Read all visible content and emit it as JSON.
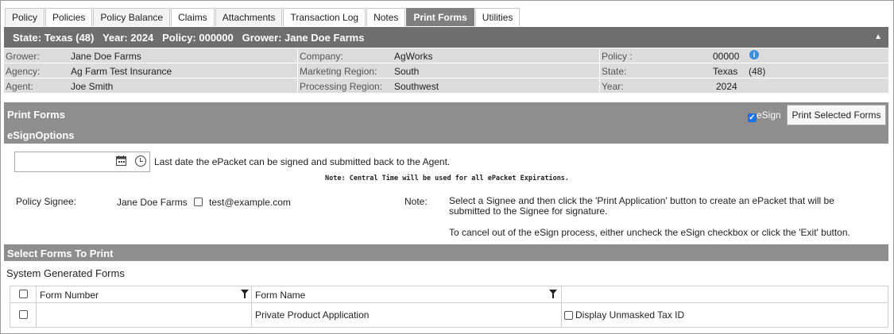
{
  "tabs": [
    "Policy",
    "Policies",
    "Policy Balance",
    "Claims",
    "Attachments",
    "Transaction Log",
    "Notes",
    "Print Forms",
    "Utilities"
  ],
  "active_tab": "Print Forms",
  "state_bar": {
    "text": "State: Texas (48)   Year: 2024   Policy: 000000   Grower: Jane Doe Farms",
    "collapse_icon": "caret-up-icon"
  },
  "info": {
    "grower_label": "Grower:",
    "grower": "Jane Doe Farms",
    "company_label": "Company:",
    "company": "AgWorks",
    "policy_label": "Policy :",
    "policy": "00000",
    "agency_label": "Agency:",
    "agency": "Ag Farm Test Insurance",
    "marketing_label": "Marketing Region:",
    "marketing": "South",
    "state_label": "State:",
    "state": "Texas",
    "state_code": "(48)",
    "agent_label": "Agent:",
    "agent": "Joe Smith",
    "processing_label": "Processing Region:",
    "processing": "Southwest",
    "year_label": "Year:",
    "year": "2024"
  },
  "print_forms": {
    "title": "Print Forms",
    "esign_options_title": "eSignOptions",
    "esign_label": "eSign",
    "esign_checked": true,
    "print_button": "Print Selected Forms"
  },
  "esign_options": {
    "date_value": "",
    "last_date_text": "Last date the ePacket can be signed and submitted back to the Agent.",
    "central_note": "Note: Central Time will be used for all ePacket Expirations.",
    "policy_signee_label": "Policy Signee:",
    "signee_name": "Jane Doe Farms",
    "signee_email": "test@example.com",
    "note_label": "Note:",
    "note_text_1": "Select a Signee and then click the 'Print Application' button to create an ePacket that will be submitted to the Signee for signature.",
    "note_text_2": "To cancel out of the eSign process, either uncheck the eSign checkbox or click the 'Exit' button."
  },
  "select_forms": {
    "title": "Select Forms To Print",
    "subtitle": "System Generated Forms",
    "columns": [
      "Form Number",
      "Form Name"
    ],
    "rows": [
      {
        "form_number": "",
        "form_name": "Private Product Application",
        "option": "Display Unmasked Tax ID"
      }
    ]
  },
  "colors": {
    "header_dark": "#6e6e6e",
    "header_mid": "#8e8e8e",
    "info_bg": "#dcdcdc",
    "accent": "#1a73e8"
  }
}
